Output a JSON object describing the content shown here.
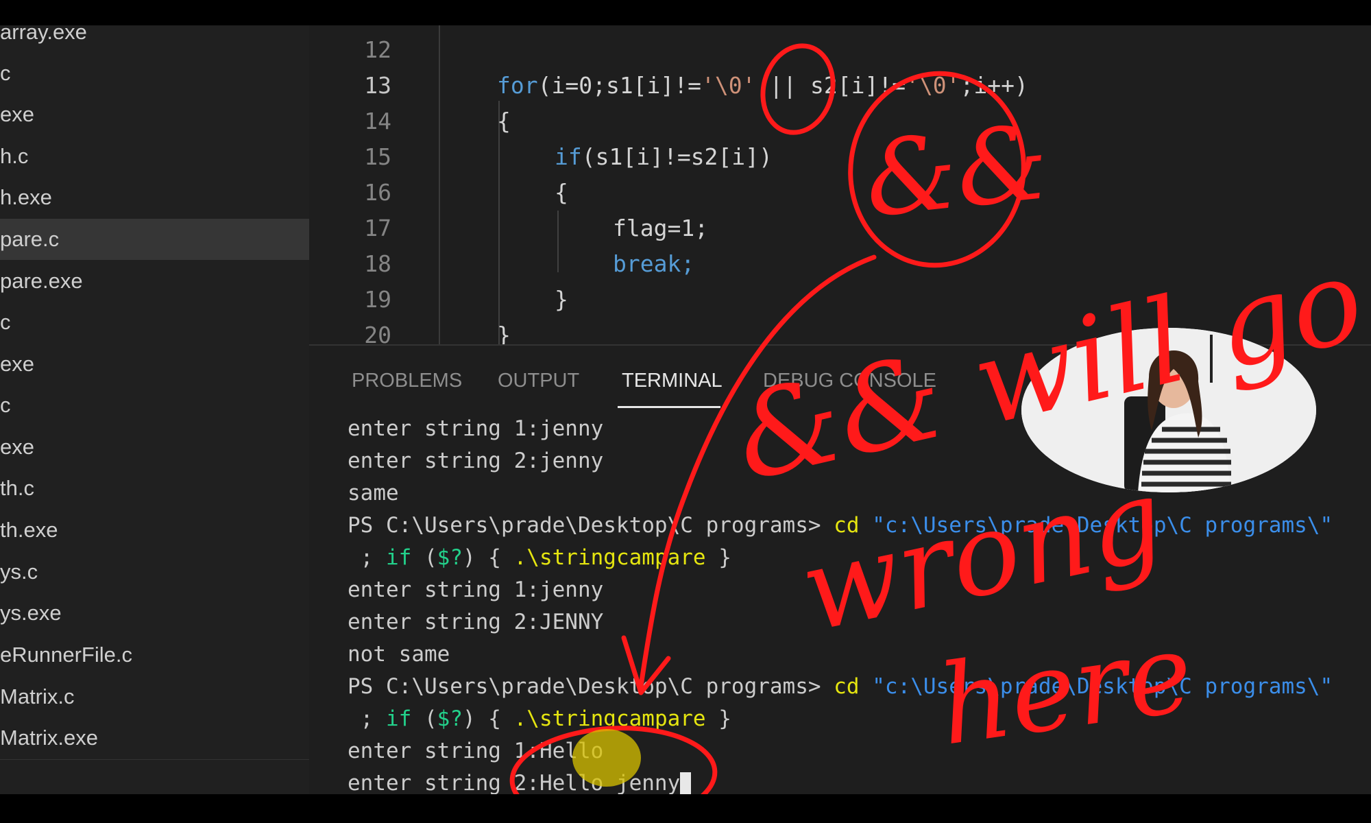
{
  "sidebar": {
    "files": [
      {
        "label": "array.exe"
      },
      {
        "label": "c"
      },
      {
        "label": "exe"
      },
      {
        "label": "h.c"
      },
      {
        "label": "h.exe"
      },
      {
        "label": "pare.c",
        "active": true
      },
      {
        "label": "pare.exe"
      },
      {
        "label": "c"
      },
      {
        "label": "exe"
      },
      {
        "label": "c"
      },
      {
        "label": "exe"
      },
      {
        "label": "th.c"
      },
      {
        "label": "th.exe"
      },
      {
        "label": "ys.c"
      },
      {
        "label": "ys.exe"
      },
      {
        "label": "eRunnerFile.c"
      },
      {
        "label": "Matrix.c"
      },
      {
        "label": "Matrix.exe"
      }
    ]
  },
  "editor": {
    "line_numbers": [
      "12",
      "13",
      "14",
      "15",
      "16",
      "17",
      "18",
      "19",
      "20"
    ],
    "current_line": "13",
    "code": {
      "l13_kw": "for",
      "l13_a": "(i=0;s1[i]!=",
      "l13_s1": "'\\0'",
      "l13_b": " || s2[i]!=",
      "l13_s2": "'\\0'",
      "l13_c": ";i++)",
      "l14": "{",
      "l15_kw": "if",
      "l15_rest": "(s1[i]!=s2[i])",
      "l16": "{",
      "l17": "flag=1;",
      "l18": "break;",
      "l19": "}",
      "l20": "}"
    }
  },
  "panel": {
    "tabs": [
      "PROBLEMS",
      "OUTPUT",
      "TERMINAL",
      "DEBUG CONSOLE"
    ],
    "active_tab": "TERMINAL"
  },
  "terminal": {
    "l1": "enter string 1:jenny",
    "l2": "enter string 2:jenny",
    "l3": "same",
    "ps_prompt": "PS C:\\Users\\prade\\Desktop\\C programs> ",
    "cd": "cd",
    "cd_path": "\"c:\\Users\\prade\\Desktop\\C programs\\\"",
    "semi": " ; ",
    "if": "if",
    "cond": " (",
    "dollar": "$?",
    "cond_end": ") { ",
    "exe": ".\\stringcampare",
    "brace_end": " }",
    "l6": "enter string 1:jenny",
    "l7": "enter string 2:JENNY",
    "l8": "not same",
    "l11": "enter string 1:Hello",
    "l12": "enter string 2:Hello jenny"
  },
  "annotation": {
    "color": "#ff1a1a",
    "highlight_color": "#d9c300",
    "handwritten_text": [
      "&&",
      "&& will go",
      "wrong",
      "here"
    ]
  },
  "icons": [
    "webcam-presenter-overlay"
  ]
}
